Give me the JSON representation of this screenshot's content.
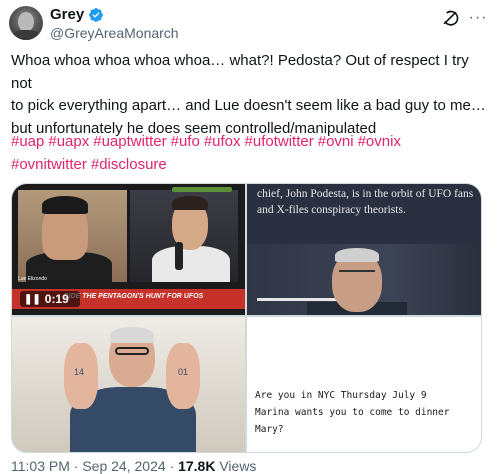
{
  "author": {
    "display_name": "Grey",
    "handle": "@GreyAreaMonarch",
    "verified": true
  },
  "icons": {
    "avatar": "profile-avatar",
    "verified": "verified-badge-icon",
    "grok": "grok-icon",
    "more": "more-options-icon",
    "pause": "pause-icon"
  },
  "tweet": {
    "text_line1": "Whoa whoa whoa whoa whoa… what?! Pedosta? Out of respect I try not",
    "text_line2": "to pick everything apart… and Lue doesn't seem like a bad guy to me…",
    "text_line3": "but unfortunately he does seem controlled/manipulated",
    "hashtags": [
      "#uap",
      "#uapx",
      "#uaptwitter",
      "#ufo",
      "#ufox",
      "#ufotwitter",
      "#ovni",
      "#ovnix",
      "#ovnitwitter",
      "#disclosure"
    ]
  },
  "media": {
    "video": {
      "time": "0:19",
      "banner": "SIDE THE PENTAGON'S HUNT FOR UFOS",
      "left_label": "Lue Elizondo"
    },
    "article_caption": "chief, John Podesta, is in the orbit of UFO fans and X-files conspiracy theorists.",
    "hand_left": "14",
    "hand_right": "01",
    "note_lines": [
      "Are you in NYC Thursday July 9",
      "Marina wants you to come to dinner",
      "Mary?"
    ]
  },
  "meta": {
    "time": "11:03 PM",
    "separator": " · ",
    "date": "Sep 24, 2024",
    "views_count": "17.8K",
    "views_label": "Views"
  },
  "colors": {
    "hashtag": "#e0246f",
    "secondary": "#536471",
    "verified": "#1d9bf0"
  }
}
